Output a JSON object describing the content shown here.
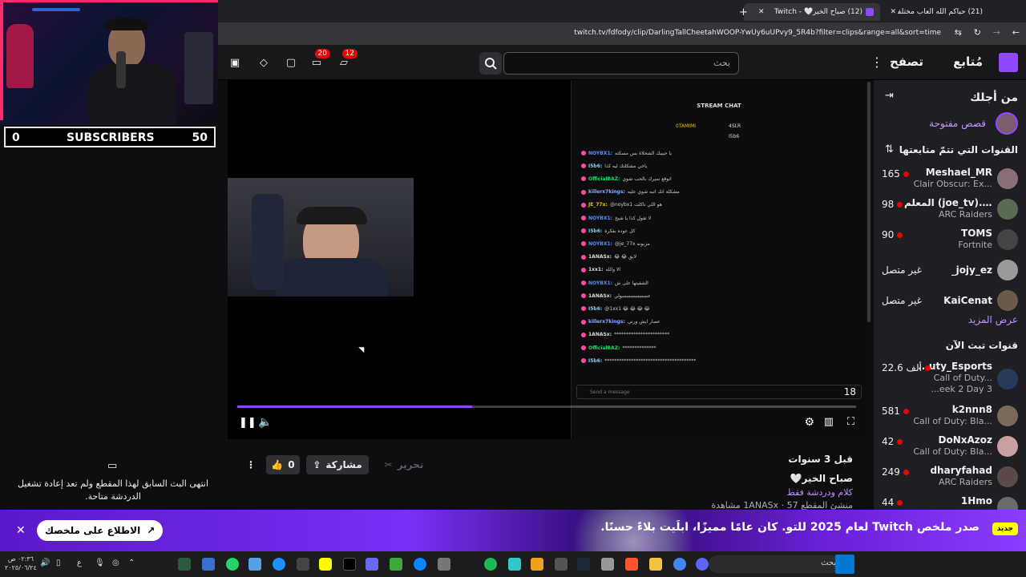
{
  "browser": {
    "tabs": [
      {
        "title": "(21) حياكم الله العاب مختلفه - ..."
      },
      {
        "title": "(12) صباح الخير🤍 - Twitch",
        "active": true
      }
    ],
    "url": "twitch.tv/fdfody/clip/DarlingTallCheetahWOOP-YwUy6uUPvy9_5R4b?filter=clips&range=all&sort=time"
  },
  "topnav": {
    "following": "مُتابع",
    "browse": "تصفح",
    "search_placeholder": "بحث",
    "notifications_count": "12",
    "inbox_count": "20"
  },
  "overlay": {
    "subs_current": "0",
    "subs_label": "SUBSCRIBERS",
    "subs_goal": "50"
  },
  "left_panel": {
    "chat_ended": "انتهى البث السابق لهذا المقطع ولم تعد إعادة تشغيل الدردشة متاحة."
  },
  "video": {
    "stream_chat_title": "STREAM CHAT",
    "viewer_count": "18",
    "send_placeholder": "Send a message",
    "top_chatters": [
      "0TAMIMI",
      "4SLR",
      "I5b6"
    ],
    "chat_lines": [
      {
        "user": "NOYBX1:",
        "msg": "يا حبيبك الشحلاة بس مسكته"
      },
      {
        "user": "I5b6:",
        "msg": "ياخي مشكلتك ليه كذا"
      },
      {
        "user": "OfficialBAZ:",
        "msg": "اتوقع سيرك بالحب شوي"
      },
      {
        "user": "killerx7kings:",
        "msg": "مشكلة انك اتبه شوي عليه"
      },
      {
        "user": "JE_77x:",
        "msg": "@noybx1 هو اللي تاكلت"
      },
      {
        "user": "NOYBX1:",
        "msg": "لا تقول كذا يا شيخ"
      },
      {
        "user": "I5b6:",
        "msg": "كل عوده بفكرة"
      },
      {
        "user": "NOYBX1:",
        "msg": "@je_77x مزبونه"
      },
      {
        "user": "1ANASx:",
        "msg": "😂 😂 لايق"
      },
      {
        "user": "1xx1:",
        "msg": "الا والله"
      },
      {
        "user": "NOYBX1:",
        "msg": "الشقيتها على ش"
      },
      {
        "user": "1ANASx:",
        "msg": "عسسسسسسولي"
      },
      {
        "user": "I5b6:",
        "msg": "@1xx1 😂 😂 😂 😂"
      },
      {
        "user": "killerx7kings:",
        "msg": "عصار ايش ورني"
      },
      {
        "user": "1ANASx:",
        "msg": "***********************"
      },
      {
        "user": "OfficialBAZ:",
        "msg": "**************"
      },
      {
        "user": "I5b6:",
        "msg": "**************************************"
      }
    ],
    "progress": 0.38
  },
  "clip": {
    "title": "صباح الخير🤍",
    "time_ago": "قبل 3 سنوات",
    "category": "كلام ودردشة فقط",
    "creator": "منشئ المقطع 1ANASx",
    "views": "57 مشاهدة",
    "likes": "0",
    "share": "مشاركة",
    "edit": "تحرير"
  },
  "sidebar": {
    "for_you": "من أجلك",
    "open_stories": "قصص مفتوحة",
    "followed_heading": "القنوات التي تتمّ متابعتها",
    "followed": [
      {
        "name": "Meshael_MR",
        "game": "Clair Obscur: Ex...",
        "viewers": "165",
        "live": true
      },
      {
        "name": "المعلم (joe_tv)... +2",
        "game": "ARC Raiders",
        "viewers": "98",
        "live": true
      },
      {
        "name": "TOMS",
        "game": "Fortnite",
        "viewers": "90",
        "live": true
      },
      {
        "name": "_jojy_ez",
        "game": "",
        "status": "غير متصل",
        "live": false
      },
      {
        "name": "KaiCenat",
        "game": "",
        "status": "غير متصل",
        "live": false
      }
    ],
    "show_more": "عرض المزيد",
    "live_heading": "قنوات تبث الآن",
    "live_channels": [
      {
        "name": "...uty_Esports",
        "game": "Call of Duty...",
        "extra": "...eek 2 Day 3",
        "viewers": "22.6 ألف"
      },
      {
        "name": "k2nnn8",
        "game": "Call of Duty: Bla...",
        "viewers": "581"
      },
      {
        "name": "DoNxAzoz",
        "game": "Call of Duty: Bla...",
        "viewers": "42"
      },
      {
        "name": "dharyfahad",
        "game": "ARC Raiders",
        "viewers": "249"
      },
      {
        "name": "1Hmo",
        "game": "",
        "viewers": "44"
      }
    ]
  },
  "banner": {
    "new_badge": "جديد",
    "text": "صدر ملخص Twitch لعام 2025 للتو. كان عامًا مميزًا، ابلَيت بلاءً حسنًا.",
    "cta": "الاطلاع على ملخصك"
  },
  "taskbar": {
    "search": "بحث",
    "time": "٠٢:٣٦ ص",
    "date": "٢٠٢٥/٠٦/٢٤"
  }
}
